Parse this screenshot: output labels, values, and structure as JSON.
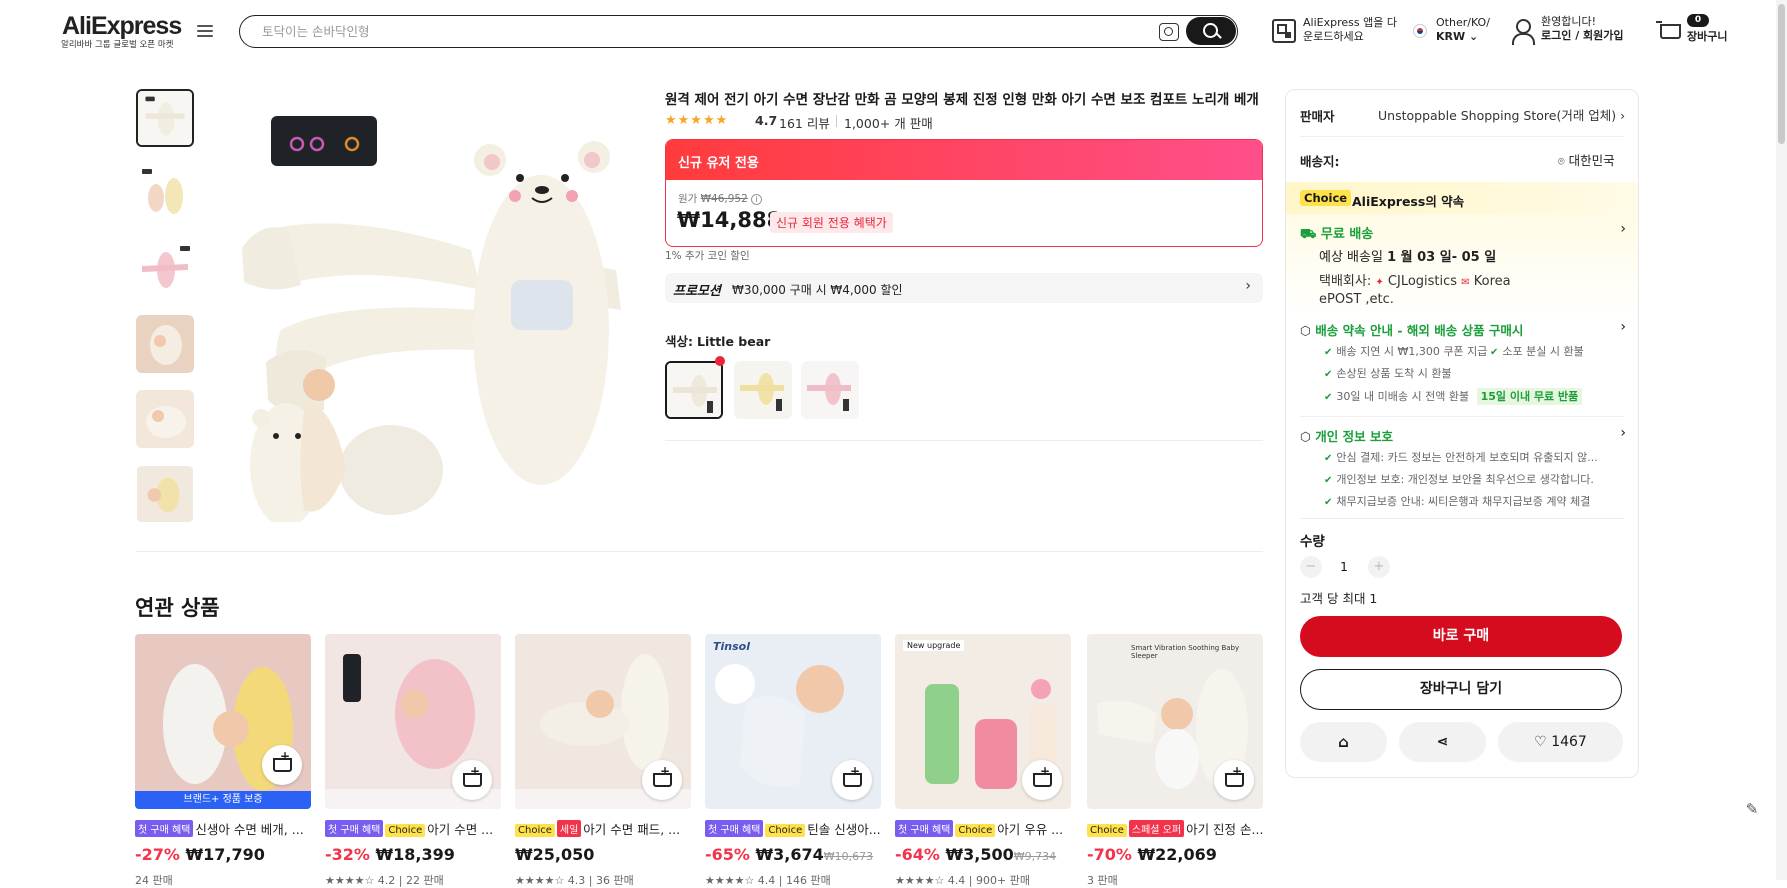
{
  "header": {
    "logo": "AliExpress",
    "logo_sub": "알리바바 그룹 글로벌 오픈 마켓",
    "search_placeholder": "토닥이는 손바닥인형",
    "app_line1": "AliExpress 앱을 다",
    "app_line2": "운로드하세요",
    "region_line1": "Other/KO/",
    "region_line2": "KRW",
    "user_line1": "환영합니다!",
    "user_line2": "로그인 / 회원가입",
    "cart_count": "0",
    "cart_label": "장바구니"
  },
  "product": {
    "title": "원격 제어 전기 아기 수면 장난감 만화 곰 모양의 봉제 진정 인형 만화 아기 수면 보조 컴포트 노리개 베개",
    "rating": "4.7",
    "reviews": "161 리뷰",
    "sold": "1,000+ 개 판매",
    "deal_banner": "신규 유저 전용",
    "orig_label": "원가",
    "orig_price": "₩46,952",
    "price": "₩14,888",
    "price_badge": "신규 회원 전용 혜택가",
    "coin_note": "1% 추가 코인 할인",
    "promo_label": "프로모션",
    "promo_text": "₩30,000 구매 시 ₩4,000 할인",
    "color_label": "색상:",
    "color_value": "Little bear"
  },
  "side": {
    "seller_label": "판매자",
    "seller_name": "Unstoppable Shopping Store(거래 업체)",
    "ship_to_label": "배송지:",
    "ship_to_value": "대한민국",
    "choice_tag": "Choice",
    "choice_promise": "AliExpress의 약속",
    "free_ship": "무료 배송",
    "eta_label": "예상 배송일",
    "eta_value": "1 월 03 일- 05 일",
    "carrier_label": "택배회사:",
    "carrier1": "CJLogistics",
    "carrier2": "Korea",
    "carrier3": "ePOST ,etc.",
    "guarantee_title": "배송 약속 안내 - 해외 배송 상품 구매시",
    "g1": "배송 지연 시 ₩1,300 쿠폰 지급",
    "g2": "소포 분실 시 환불",
    "g3": "손상된 상품 도착 시 환불",
    "g4": "30일 내 미배송 시 전액 환불",
    "g4_badge": "15일 이내 무료 반품",
    "privacy_title": "개인 정보 보호",
    "p1": "안심 결제: 카드 정보는 안전하게 보호되며 유출되지 않...",
    "p2": "개인정보 보호: 개인정보 보안을 최우선으로 생각합니다.",
    "p3": "채무지급보증 안내: 씨티은행과 채무지급보증 계약 체결",
    "qty_label": "수량",
    "qty_minus": "−",
    "qty_value": "1",
    "qty_plus": "+",
    "qty_limit": "고객 당 최대 1",
    "buy_now": "바로 구매",
    "add_cart": "장바구니 담기",
    "wish_count": "1467"
  },
  "related": {
    "heading": "연관 상품",
    "items": [
      {
        "tags": [
          "브랜드+ 정품 보증"
        ],
        "name": "신생아 수면 베개, ...",
        "discount": "-27%",
        "price": "₩17,790",
        "orig": "",
        "meta": "24 판매"
      },
      {
        "tags": [
          "첫 구매 혜택",
          "Choice"
        ],
        "name": "아기 수면 ...",
        "discount": "-32%",
        "price": "₩18,399",
        "orig": "",
        "meta": "★★★★☆ 4.2 | 22 판매"
      },
      {
        "tags": [
          "Choice",
          "세일"
        ],
        "name": "아기 수면 패드, ...",
        "discount": "",
        "price": "₩25,050",
        "orig": "",
        "meta": "★★★★☆ 4.3 | 36 판매"
      },
      {
        "tags": [
          "첫 구매 혜택",
          "Choice"
        ],
        "name": "틴솔 신생아...",
        "discount": "-65%",
        "price": "₩3,674",
        "orig": "₩10,673",
        "meta": "★★★★☆ 4.4 | 146 판매"
      },
      {
        "tags": [
          "첫 구매 혜택",
          "Choice"
        ],
        "name": "아기 우유 ...",
        "discount": "-64%",
        "price": "₩3,500",
        "orig": "₩9,734",
        "meta": "★★★★☆ 4.4 | 900+ 판매"
      },
      {
        "tags": [
          "Choice",
          "스페셜 오퍼"
        ],
        "name": "아기 진정 손...",
        "discount": "-70%",
        "price": "₩22,069",
        "orig": "",
        "meta": "3 판매"
      }
    ],
    "image_texts": {
      "tinsol": "Tinsol",
      "new_upgrade": "New upgrade",
      "smart": "Smart Vibration Soothing Baby Sleeper"
    }
  },
  "colors": {
    "accent": "#f2334b",
    "buy": "#d40c1e",
    "choice": "#ffe14a"
  }
}
